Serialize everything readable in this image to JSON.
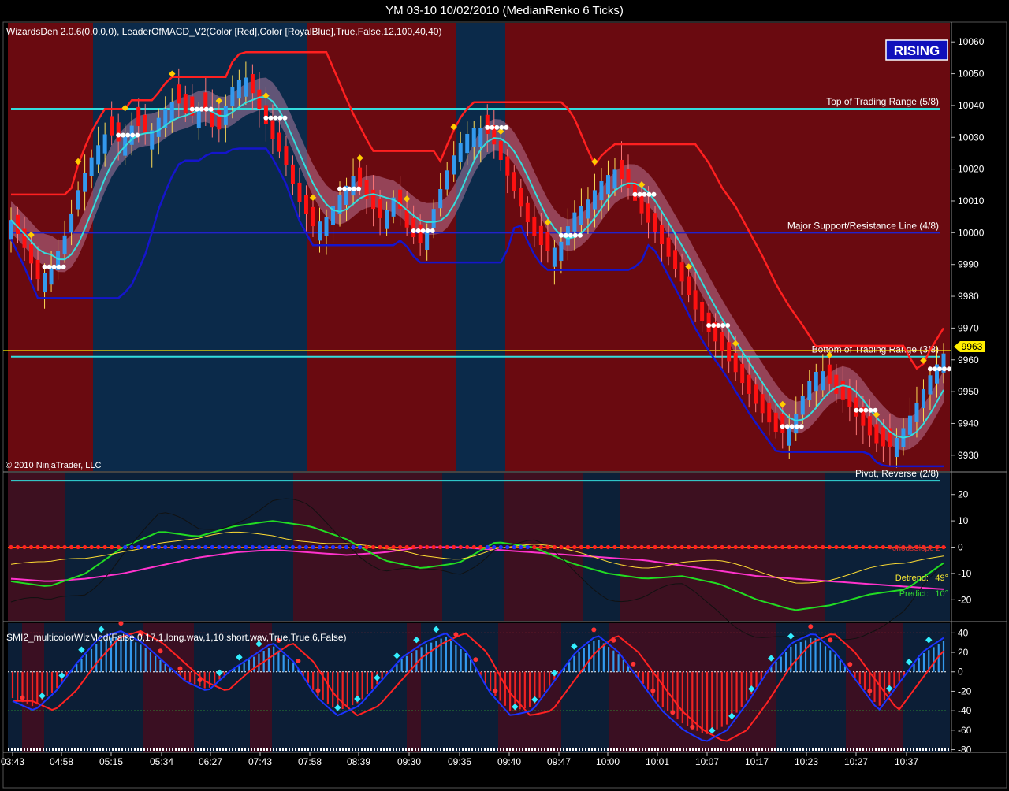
{
  "window": {
    "title": "YM 03-10  10/02/2010 (MedianRenko 6 Ticks)"
  },
  "price_panel": {
    "indicator_label": "WizardsDen 2.0.6(0,0,0,0), LeaderOfMACD_V2(Color [Red],Color [RoyalBlue],True,False,12,100,40,40)",
    "copyright": "© 2010 NinjaTrader, LLC",
    "trend_badge": "RISING",
    "last_price_tag": "9963",
    "lines": [
      {
        "label": "Top of Trading Range (5/8)",
        "value": 10039,
        "color": "#33dddd"
      },
      {
        "label": "Major Support/Resistance Line (4/8)",
        "value": 10000,
        "color": "#2222cc"
      },
      {
        "label": "Bottom of Trading Range (3/8)",
        "value": 9961,
        "color": "#33dddd"
      },
      {
        "label": "Pivot, Reverse (2/8)",
        "value": 9922,
        "color": "#33dddd"
      }
    ]
  },
  "osc_panel": {
    "label_top": "PeriodsSlope 2",
    "label_detrend": "Detrend:",
    "detrend_value": "49°",
    "label_predict": "Predict:",
    "predict_value": "10°"
  },
  "smi_panel": {
    "indicator_label": "SMI2_multicolorWizMod(False,0,17,1,long.wav,1,10,short.wav,True,True,6,False)"
  },
  "colors": {
    "bull_bg": "#0b2a4a",
    "bear_bg": "#6a0a10",
    "up_bar": "#3399ee",
    "down_bar": "#ff1111",
    "cyan": "#33dddd",
    "blue": "#1515cc",
    "red": "#ff2020",
    "gold": "#ffcc00"
  },
  "chart_data": [
    {
      "type": "candlestick",
      "title": "YM 03-10  10/02/2010 (MedianRenko 6 Ticks)",
      "y_ticks": [
        10060,
        10050,
        10040,
        10030,
        10020,
        10010,
        10000,
        9990,
        9980,
        9970,
        9960,
        9950,
        9940,
        9930
      ],
      "ylim": [
        9925,
        10066
      ],
      "x_ticks": [
        "03:43",
        "04:58",
        "05:15",
        "05:34",
        "06:27",
        "07:43",
        "07:58",
        "08:39",
        "09:30",
        "09:35",
        "09:40",
        "09:47",
        "10:00",
        "10:01",
        "10:07",
        "10:17",
        "10:23",
        "10:27",
        "10:37"
      ],
      "close_path": [
        10004,
        9995,
        9985,
        9990,
        10000,
        10015,
        10025,
        10032,
        10028,
        10035,
        10030,
        10038,
        10042,
        10036,
        10040,
        10030,
        10045,
        10050,
        10040,
        10030,
        10022,
        10010,
        10002,
        10005,
        10012,
        10018,
        10010,
        10004,
        10012,
        10000,
        9996,
        10010,
        10022,
        10030,
        10034,
        10030,
        10020,
        10010,
        10000,
        9994,
        9996,
        10006,
        10010,
        10016,
        10020,
        10014,
        10006,
        10000,
        9992,
        9984,
        9975,
        9968,
        9962,
        9955,
        9948,
        9942,
        9936,
        9940,
        9952,
        9958,
        9950,
        9946,
        9940,
        9934,
        9932,
        9938,
        9946,
        9955,
        9962
      ],
      "last": 9963
    },
    {
      "type": "line",
      "title": "",
      "y_ticks": [
        20,
        10,
        0,
        -10,
        -20
      ],
      "ylim": [
        -28,
        28
      ],
      "series": [
        {
          "name": "",
          "color": "#ff33cc",
          "values": [
            -12,
            -13,
            -12,
            -10,
            -7,
            -4,
            -2,
            -1,
            -2,
            -3,
            -2,
            0,
            0,
            -1,
            -2,
            -3,
            -4,
            -5,
            -7,
            -9,
            -11,
            -12,
            -13,
            -14,
            -15,
            -16
          ]
        },
        {
          "name": "",
          "color": "#22dd22",
          "values": [
            -13,
            -15,
            -10,
            0,
            6,
            4,
            8,
            10,
            8,
            3,
            -5,
            -8,
            -6,
            2,
            0,
            -6,
            -10,
            -12,
            -11,
            -14,
            -20,
            -24,
            -22,
            -18,
            -16,
            -6
          ]
        }
      ]
    },
    {
      "type": "bar",
      "title": "SMI2_multicolorWizMod(False,0,17,1,long.wav,1,10,short.wav,True,True,6,False)",
      "y_ticks": [
        40,
        20,
        0,
        -20,
        -40,
        -60,
        -80
      ],
      "ylim": [
        -82,
        50
      ],
      "smi_path": [
        -30,
        -40,
        -20,
        10,
        35,
        42,
        30,
        10,
        -10,
        -20,
        0,
        15,
        30,
        10,
        -25,
        -45,
        -35,
        -10,
        15,
        30,
        40,
        20,
        -20,
        -45,
        -40,
        -10,
        20,
        38,
        20,
        -10,
        -40,
        -60,
        -72,
        -60,
        -30,
        5,
        30,
        40,
        20,
        -10,
        -40,
        -10,
        20,
        35
      ]
    }
  ]
}
